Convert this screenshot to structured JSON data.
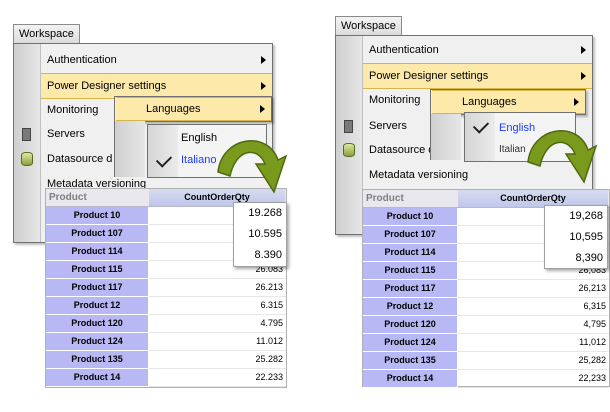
{
  "workspace_tab": "Workspace",
  "menu": {
    "items": [
      "Authentication",
      "Power Designer settings",
      "Monitoring",
      "Servers",
      "Datasource d",
      "Metadata versioning"
    ]
  },
  "submenu": {
    "label": "Languages"
  },
  "languages": {
    "option1": "English",
    "option2_left": "Italiano",
    "option2_right": "Italian"
  },
  "grid": {
    "header_product": "Product",
    "header_value": "CountOrderQty",
    "rows": [
      {
        "product": "Product 10",
        "value": "19.268"
      },
      {
        "product": "Product 107",
        "value": "10.595"
      },
      {
        "product": "Product 114",
        "value": "8.390"
      },
      {
        "product": "Product 115",
        "value": "26.083"
      },
      {
        "product": "Product 117",
        "value": "26.213"
      },
      {
        "product": "Product 12",
        "value": "6.315"
      },
      {
        "product": "Product 120",
        "value": "4.795"
      },
      {
        "product": "Product 124",
        "value": "11.012"
      },
      {
        "product": "Product 135",
        "value": "25.282"
      },
      {
        "product": "Product 14",
        "value": "22.233"
      }
    ]
  },
  "grid_right": {
    "rows": [
      {
        "product": "Product 10",
        "value": ""
      },
      {
        "product": "Product 107",
        "value": ""
      },
      {
        "product": "Product 114",
        "value": ""
      },
      {
        "product": "Product 115",
        "value": "26,083"
      },
      {
        "product": "Product 117",
        "value": "26,213"
      },
      {
        "product": "Product 12",
        "value": "6,315"
      },
      {
        "product": "Product 120",
        "value": "4,795"
      },
      {
        "product": "Product 124",
        "value": "11,012"
      },
      {
        "product": "Product 135",
        "value": "25,282"
      },
      {
        "product": "Product 14",
        "value": "22,233"
      }
    ],
    "popout": [
      "19,268",
      "10,595",
      "8,390"
    ]
  },
  "popout_left": [
    "19.268",
    "10.595",
    "8.390"
  ],
  "colors": {
    "highlight": "#fde9a9",
    "header_blue": "#b8b8f4",
    "arrow_green": "#7a9a1e"
  }
}
